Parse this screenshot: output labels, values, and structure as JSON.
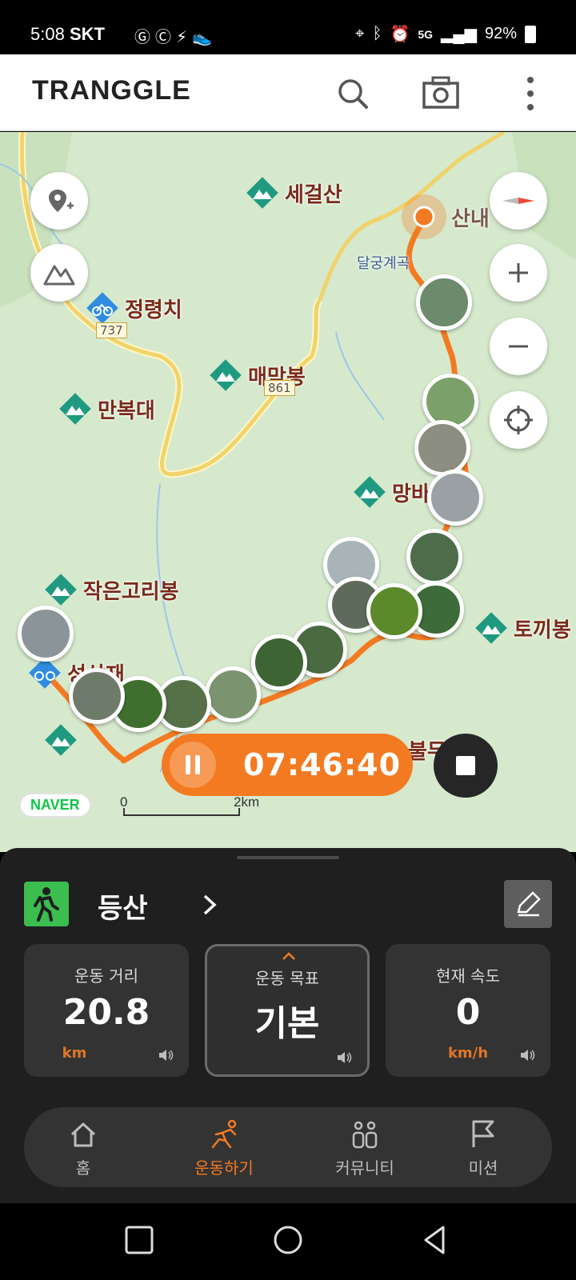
{
  "status_bar": {
    "time": "5:08",
    "carrier": "SKT",
    "battery": "92%",
    "left_icons": [
      "google-icon",
      "c-app-icon",
      "usb-icon",
      "shoe-icon"
    ],
    "right_icons": [
      "location-icon",
      "bluetooth-icon",
      "alarm-icon",
      "5g-icon",
      "signal-icon"
    ]
  },
  "header": {
    "logo": "TRANGGLE",
    "icons": [
      "search-icon",
      "camera-icon",
      "more-icon"
    ]
  },
  "map": {
    "pois": [
      {
        "label": "세걸산"
      },
      {
        "label": "정령치"
      },
      {
        "label": "매막봉"
      },
      {
        "label": "만복대"
      },
      {
        "label": "망바"
      },
      {
        "label": "작은고리봉"
      },
      {
        "label": "토끼봉"
      },
      {
        "label": "성삼재"
      },
      {
        "label": "불무장등"
      },
      {
        "label": "산내"
      },
      {
        "label": "달궁계곡"
      }
    ],
    "road_numbers": [
      "737",
      "861"
    ],
    "timer": "07:46:40",
    "naver": "NAVER",
    "scale_start": "0",
    "scale_end": "2km",
    "accent_color": "#f47a22"
  },
  "sheet": {
    "activity": "등산",
    "cards": [
      {
        "title": "운동 거리",
        "value": "20.8",
        "unit": "km"
      },
      {
        "title": "운동 목표",
        "value": "기본",
        "unit": ""
      },
      {
        "title": "현재 속도",
        "value": "0",
        "unit": "km/h"
      }
    ]
  },
  "nav": {
    "items": [
      {
        "label": "홈"
      },
      {
        "label": "운동하기"
      },
      {
        "label": "커뮤니티"
      },
      {
        "label": "미션"
      }
    ]
  }
}
